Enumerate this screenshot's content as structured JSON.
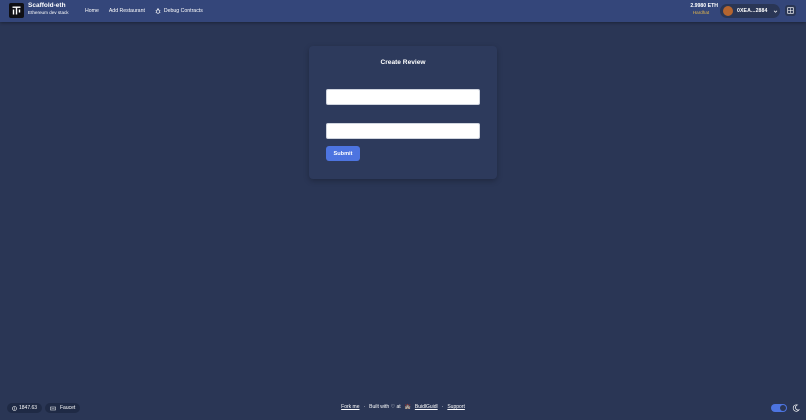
{
  "header": {
    "brand_title": "Scaffold-eth",
    "brand_subtitle": "Ethereum dev stack",
    "nav": [
      {
        "label": "Home"
      },
      {
        "label": "Add Restaurant"
      },
      {
        "label": "Debug Contracts",
        "icon": "bug-icon"
      }
    ],
    "balance": "2.9980 ETH",
    "network": "Hardhat",
    "account_address": "0XEA...2884",
    "colors": {
      "header_bg": "#34467a",
      "network": "#e6b84a"
    }
  },
  "form": {
    "title": "Create Review",
    "fields": [
      {
        "label": "",
        "value": "",
        "placeholder": ""
      },
      {
        "label": "",
        "value": "",
        "placeholder": ""
      }
    ],
    "submit_label": "Submit",
    "colors": {
      "button": "#4d74e0"
    }
  },
  "footer": {
    "price": "1847.63",
    "faucet_label": "Faucet",
    "fork_label": "Fork me",
    "separator": "·",
    "built_with_prefix": "Built with",
    "built_with_at": "at",
    "buidlguidl_label": "BuidlGuidl",
    "support_label": "Support"
  }
}
